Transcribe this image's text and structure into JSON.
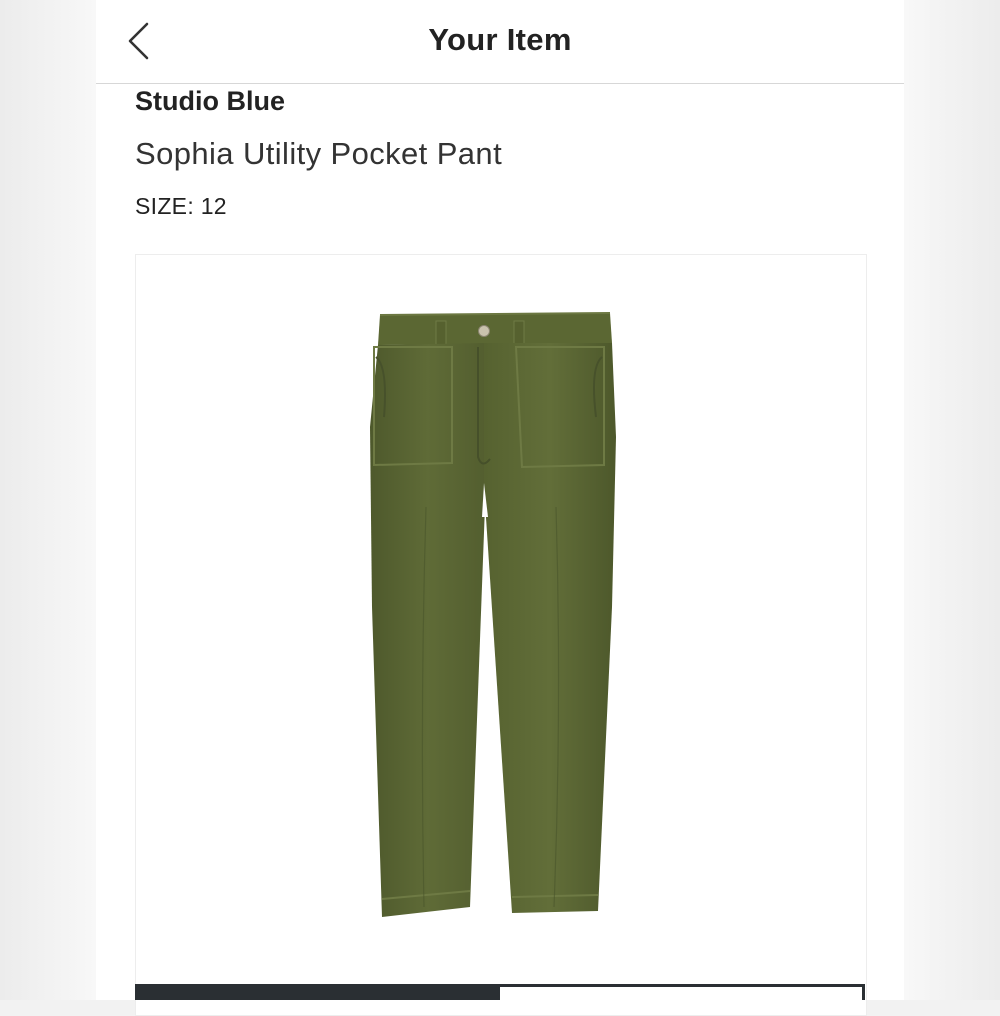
{
  "header": {
    "title": "Your Item",
    "back_icon": "chevron-left-icon"
  },
  "item": {
    "brand": "Studio Blue",
    "name": "Sophia Utility Pocket Pant",
    "size_text": "SIZE: 12",
    "image_alt": "olive green utility pocket pant",
    "color": "#5a6634"
  },
  "colors": {
    "divider": "#d7d7d7",
    "tab_dark": "#2a2f33",
    "side_bg": "#f2f2f2"
  }
}
